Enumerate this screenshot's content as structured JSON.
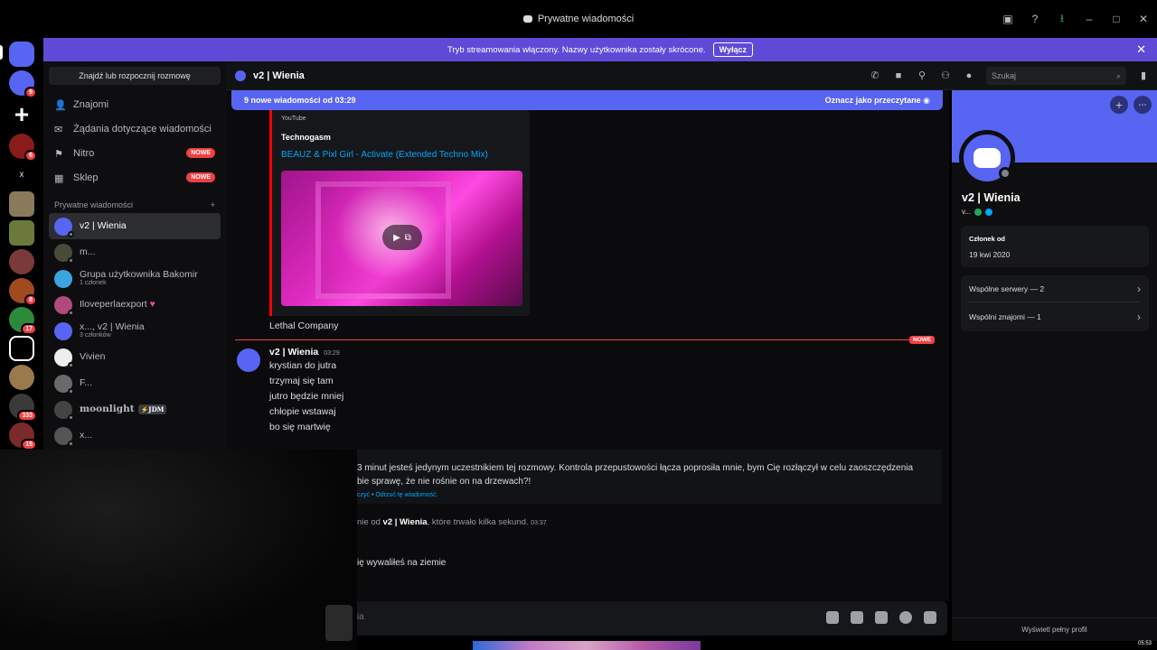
{
  "window": {
    "title": "Prywatne wiadomości"
  },
  "banner": {
    "text": "Tryb streamowania włączony. Nazwy użytkownika zostały skrócone.",
    "button": "Wyłącz"
  },
  "rail": {
    "badges": [
      "9",
      "6",
      "8",
      "17",
      "333",
      "15"
    ],
    "x_label": "x"
  },
  "sidebar": {
    "find_button": "Znajdź lub rozpocznij rozmowę",
    "nav": [
      {
        "label": "Znajomi"
      },
      {
        "label": "Żądania dotyczące wiadomości"
      },
      {
        "label": "Nitro",
        "badge": "NOWE"
      },
      {
        "label": "Sklep",
        "badge": "NOWE"
      }
    ],
    "dm_header": "Prywatne wiadomości",
    "dms": [
      {
        "name": "v2 | Wienia",
        "sub": ""
      },
      {
        "name": "m...",
        "sub": ""
      },
      {
        "name": "Grupa użytkownika Bakomir",
        "sub": "1 członek"
      },
      {
        "name": "Iloveperlaexport",
        "sub": ""
      },
      {
        "name": "x..., v2 | Wienia",
        "sub": "3 członków"
      },
      {
        "name": "Vivien",
        "sub": ""
      },
      {
        "name": "F...",
        "sub": ""
      },
      {
        "name": "moonlight",
        "sub": "",
        "tag": "⚡JDM"
      },
      {
        "name": "x...",
        "sub": ""
      }
    ]
  },
  "header": {
    "channel": "v2 | Wienia",
    "search_placeholder": "Szukaj"
  },
  "chat": {
    "new_bar": {
      "text": "9 nowe wiadomości od 03:29",
      "action": "Oznacz jako przeczytane"
    },
    "embed": {
      "provider": "YouTube",
      "author": "Technogasm",
      "title": "BEAUZ & Pixl Girl - Activate (Extended Techno Mix)"
    },
    "prev_text": "Lethal Company",
    "divider_badge": "NOWE",
    "message": {
      "author": "v2 | Wienia",
      "time": "03:29",
      "lines": [
        "krystian do jutra",
        "trzymaj się tam",
        "jutro będzie mniej",
        "chłopie wstawaj",
        "bo się martwię"
      ]
    },
    "system": {
      "text": "3 minut jesteś jedynym uczestnikiem tej rozmowy. Kontrola przepustowości łącza poprosiła mnie, bym Cię rozłączył w celu zaoszczędzenia",
      "text2": "bie sprawę, że nie rośnie on na drzewach?!",
      "link1": "czyć",
      "link2": "Odrzuć tę wiadomość."
    },
    "call": {
      "prefix": "nie od",
      "name": "v2 | Wienia",
      "suffix": ", które trwało kilka sekund.",
      "time": "03:37"
    },
    "last_line": "ię wywaliłeś na ziemie",
    "composer_placeholder": "ia"
  },
  "profile": {
    "name": "v2 | Wienia",
    "tag": "v...",
    "member_label": "Członek od",
    "member_date": "19 kwi 2020",
    "servers": "Wspólne serwery — 2",
    "friends": "Wspólni znajomi — 1",
    "full_profile": "Wyświetl pełny profil"
  },
  "taskbar": {
    "clock": "05:53"
  },
  "colors": {
    "blurple": "#5865f2",
    "banner": "#5f4ad8",
    "danger": "#f23f43",
    "link": "#00a8fc",
    "youtube": "#ff0000"
  }
}
